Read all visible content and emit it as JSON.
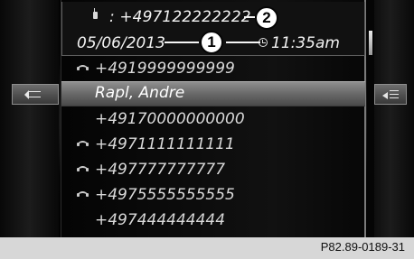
{
  "detail": {
    "number": ": +497122222222",
    "date": "05/06/2013",
    "time": "11:35am",
    "icons": {
      "phone": "mobile-phone-icon",
      "clock": "clock-icon"
    }
  },
  "callouts": {
    "one": "1",
    "two": "2"
  },
  "list": {
    "entries": [
      {
        "text": "+4919999999999",
        "icon": "telephone-handset-icon"
      },
      {
        "text": "Rapl, Andre",
        "selected": true
      },
      {
        "text": "+49170000000000"
      },
      {
        "text": "+4971111111111",
        "icon": "telephone-handset-icon"
      },
      {
        "text": "+497777777777",
        "icon": "telephone-handset-icon"
      },
      {
        "text": "+4975555555555",
        "icon": "telephone-handset-icon"
      },
      {
        "text": "+497444444444"
      }
    ]
  },
  "controls": {
    "back_icon": "back-arrow-icon",
    "options_icon": "options-menu-icon"
  },
  "caption": {
    "code": "P82.89-0189-31"
  }
}
